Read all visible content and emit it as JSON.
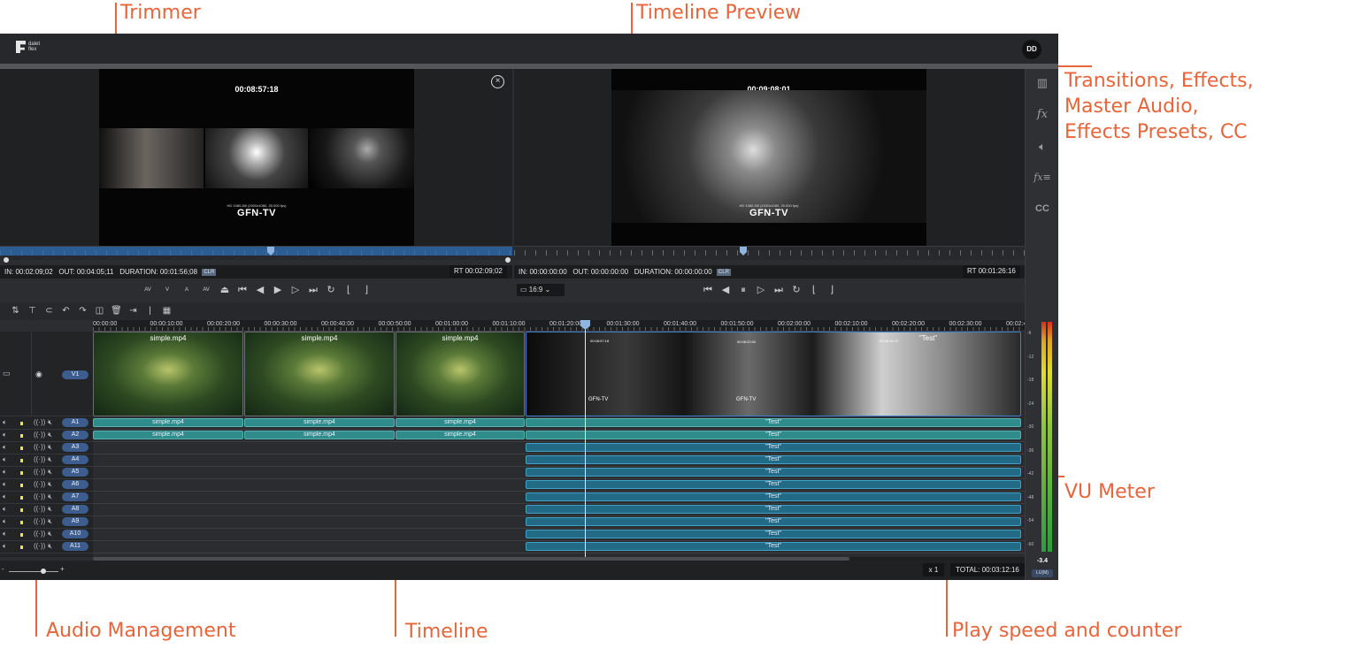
{
  "annotations": {
    "trimmer": "Trimmer",
    "timeline_preview": "Timeline Preview",
    "right_panel_line1": "Transitions, Effects,",
    "right_panel_line2": "Master Audio,",
    "right_panel_line3": "Effects Presets, CC",
    "vu_meter": "VU Meter",
    "audio_management": "Audio Management",
    "timeline": "Timeline",
    "play_speed": "Play speed and counter",
    "color": "#e8643a"
  },
  "header": {
    "logo_text": "dalet flex",
    "avatar": "DD"
  },
  "trimmer": {
    "timecode": "00:08:57:18",
    "format": "HD 1080-50i (1920x1080, 25.000 fps)",
    "channel": "GFN-TV",
    "in": "IN: 00:02:09;02",
    "out": "OUT: 00:04:05;11",
    "duration": "DURATION: 00:01:56;08",
    "clr": "CLR",
    "rt": "RT 00:02:09;02",
    "close_icon": "close-circle-icon"
  },
  "preview": {
    "timecode": "00:09:08:01",
    "format": "HD 1080-50i (1920x1080, 25.000 fps)",
    "channel": "GFN-TV",
    "in": "IN: 00:00:00:00",
    "out": "OUT: 00:00:00:00",
    "duration": "DURATION: 00:00:00:00",
    "clr": "CLR",
    "rt": "RT 00:01:26:16",
    "aspect": "16:9"
  },
  "trimmer_controls": [
    "AV",
    "V",
    "A",
    "AV"
  ],
  "ruler": [
    "00:00:00",
    "00:00:10:00",
    "00:00:20:00",
    "00:00:30:00",
    "00:00:40:00",
    "00:00:50:00",
    "00:01:00:00",
    "00:01:10:00",
    "00:01:20:00",
    "00:01:30:00",
    "00:01:40:00",
    "00:01:50:00",
    "00:02:00:00",
    "00:02:10:00",
    "00:02:20:00",
    "00:02:30:00",
    "00:02:40:00"
  ],
  "video_track": {
    "name": "V1",
    "clips": [
      "simple.mp4",
      "simple.mp4",
      "simple.mp4"
    ],
    "test_label": "\"Test\"",
    "thumb_tc1": "00:08:57:18",
    "thumb_tc2": "00:08:22:00",
    "thumb_tc3": "00:08:34:20",
    "thumb_gfn": "GFN-TV"
  },
  "audio_tracks": [
    "A1",
    "A2",
    "A3",
    "A4",
    "A5",
    "A6",
    "A7",
    "A8",
    "A9",
    "A10",
    "A11"
  ],
  "audio_clip_simple": "simple.mp4",
  "audio_clip_test": "\"Test\"",
  "vu": {
    "scale": [
      "6",
      "2",
      "-6",
      "-12",
      "-18",
      "-24",
      "-30",
      "-36",
      "-42",
      "-48",
      "-54",
      "-60"
    ],
    "value": "-3.4",
    "unit": "LU(M)"
  },
  "speed": "x 1",
  "total": "TOTAL: 00:03:12:16",
  "zoom_minus": "-",
  "zoom_plus": "+"
}
